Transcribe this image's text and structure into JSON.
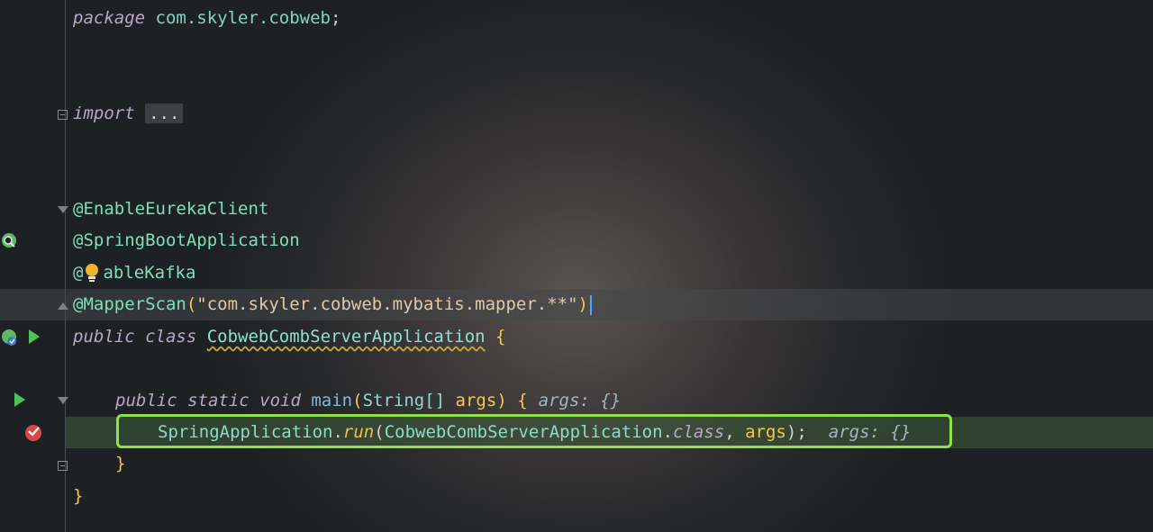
{
  "code": {
    "package_kw": "package",
    "package_name": "com.skyler.cobweb",
    "semicolon": ";",
    "import_kw": "import",
    "import_fold": "...",
    "ann1": "@EnableEurekaClient",
    "ann2": "@SpringBootApplication",
    "ann3_prefix": "@",
    "ann3_suffix": "ableKafka",
    "ann4": "@MapperScan",
    "ann4_open": "(",
    "ann4_str": "\"com.skyler.cobweb.mybatis.mapper.**\"",
    "ann4_close": ")",
    "class_kw": "public class",
    "class_name": "CobwebCombServerApplication",
    "open_brace": "{",
    "main_kw": "public static void",
    "main_name": "main",
    "main_params_open": "(",
    "main_param_type": "String[]",
    "main_param_name": "args",
    "main_params_close": ")",
    "main_hint": "args: {}",
    "run_class": "SpringApplication",
    "dot": ".",
    "run_method": "run",
    "run_open": "(",
    "run_arg_class": "CobwebCombServerApplication",
    "run_class_kw": "class",
    "run_sep": ", ",
    "run_arg2": "args",
    "run_close": ");",
    "run_hint": "args: {}",
    "close_method": "}",
    "close_class": "}"
  },
  "icons": {
    "spring_bean": "spring-bean-icon",
    "run_gutter": "run-gutter-icon",
    "breakpoint": "breakpoint-check-icon",
    "intention_bulb": "intention-bulb-icon"
  },
  "colors": {
    "accent_frame": "#8ee04c",
    "breakpoint": "#d94848",
    "run": "#4cc25a"
  }
}
